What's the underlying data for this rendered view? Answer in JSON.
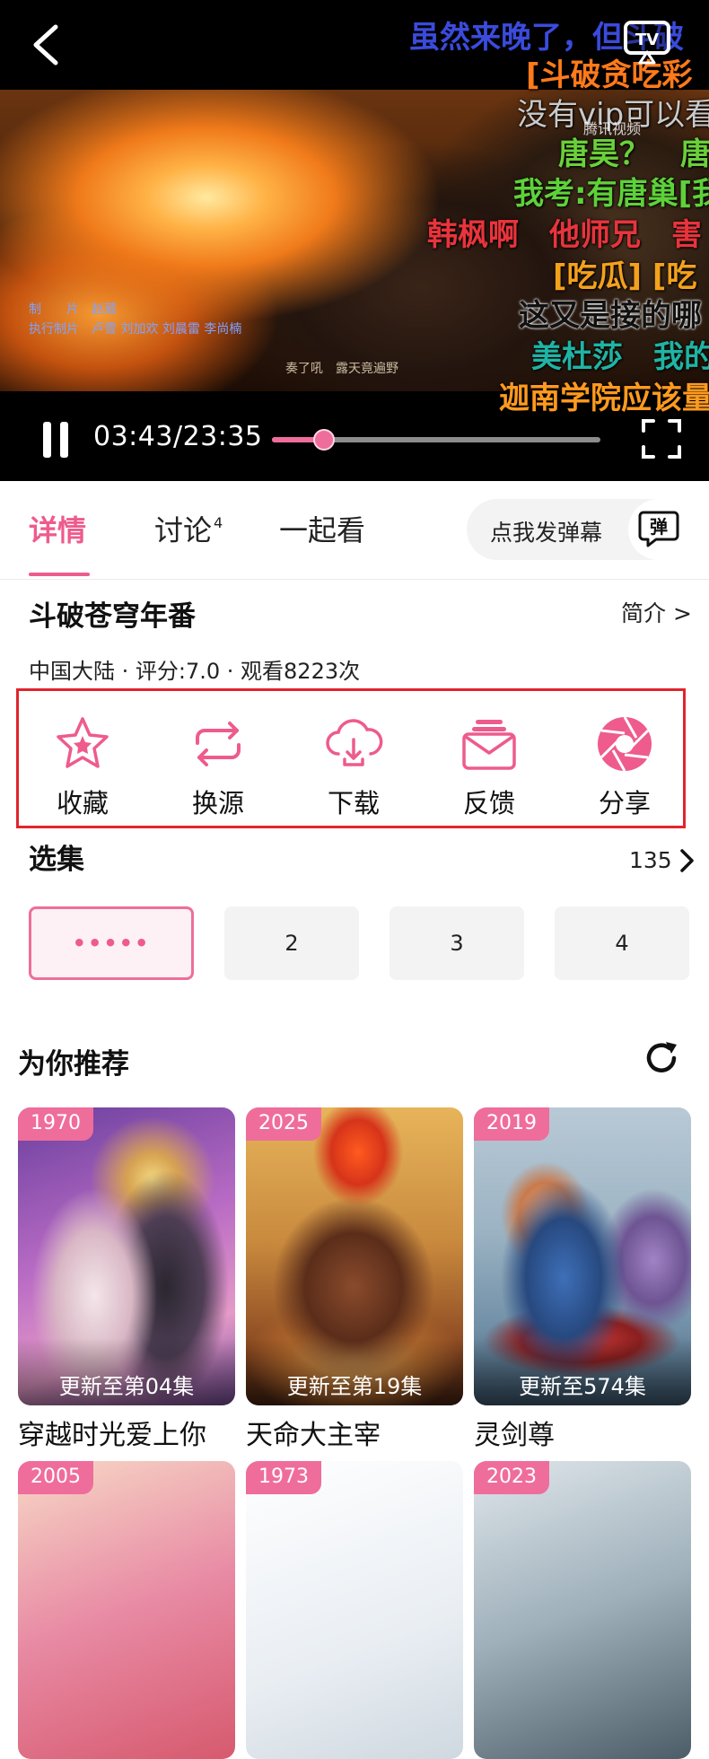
{
  "player": {
    "credits": [
      "制　　片　赵葳",
      "执行制片　卢雪  刘加欢  刘晨雷  李尚楠"
    ],
    "subtitle": "奏了吼　露天竟遍野",
    "danmaku": [
      "虽然来晚了，但斗破",
      "[斗破贪吃彩",
      "没有vip可以看",
      "唐昊？　唐",
      "我考:有唐巢[我",
      "韩枫啊　他师兄　害",
      "[吃瓜] [吃",
      "这又是接的哪",
      "美杜莎　我的",
      "迦南学院应该量"
    ],
    "watermark": "腾讯视频",
    "time": "03:43/23:35",
    "progress": 0.158
  },
  "tabs": {
    "details": "详情",
    "discuss": "讨论",
    "discuss_count": "4",
    "watch_together": "一起看"
  },
  "danmaku_send": {
    "label": "点我发弹幕",
    "icon_text": "弹"
  },
  "show": {
    "title": "斗破苍穹年番",
    "intro_link": "简介 >",
    "meta": "中国大陆 · 评分:7.0 · 观看8223次"
  },
  "actions": {
    "favorite": "收藏",
    "switch_source": "换源",
    "download": "下载",
    "feedback": "反馈",
    "share": "分享"
  },
  "episodes": {
    "title": "选集",
    "count": "135",
    "current": "•••••",
    "items": [
      "2",
      "3",
      "4"
    ]
  },
  "recommend": {
    "title": "为你推荐",
    "cards": [
      {
        "year": "1970",
        "update": "更新至第04集",
        "title": "穿越时光爱上你"
      },
      {
        "year": "2025",
        "update": "更新至第19集",
        "title": "天命大主宰"
      },
      {
        "year": "2019",
        "update": "更新至574集",
        "title": "灵剑尊"
      },
      {
        "year": "2005"
      },
      {
        "year": "1973"
      },
      {
        "year": "2023"
      }
    ]
  },
  "colors": {
    "accent": "#ee5b8c",
    "highlight_border": "#e0252e"
  }
}
